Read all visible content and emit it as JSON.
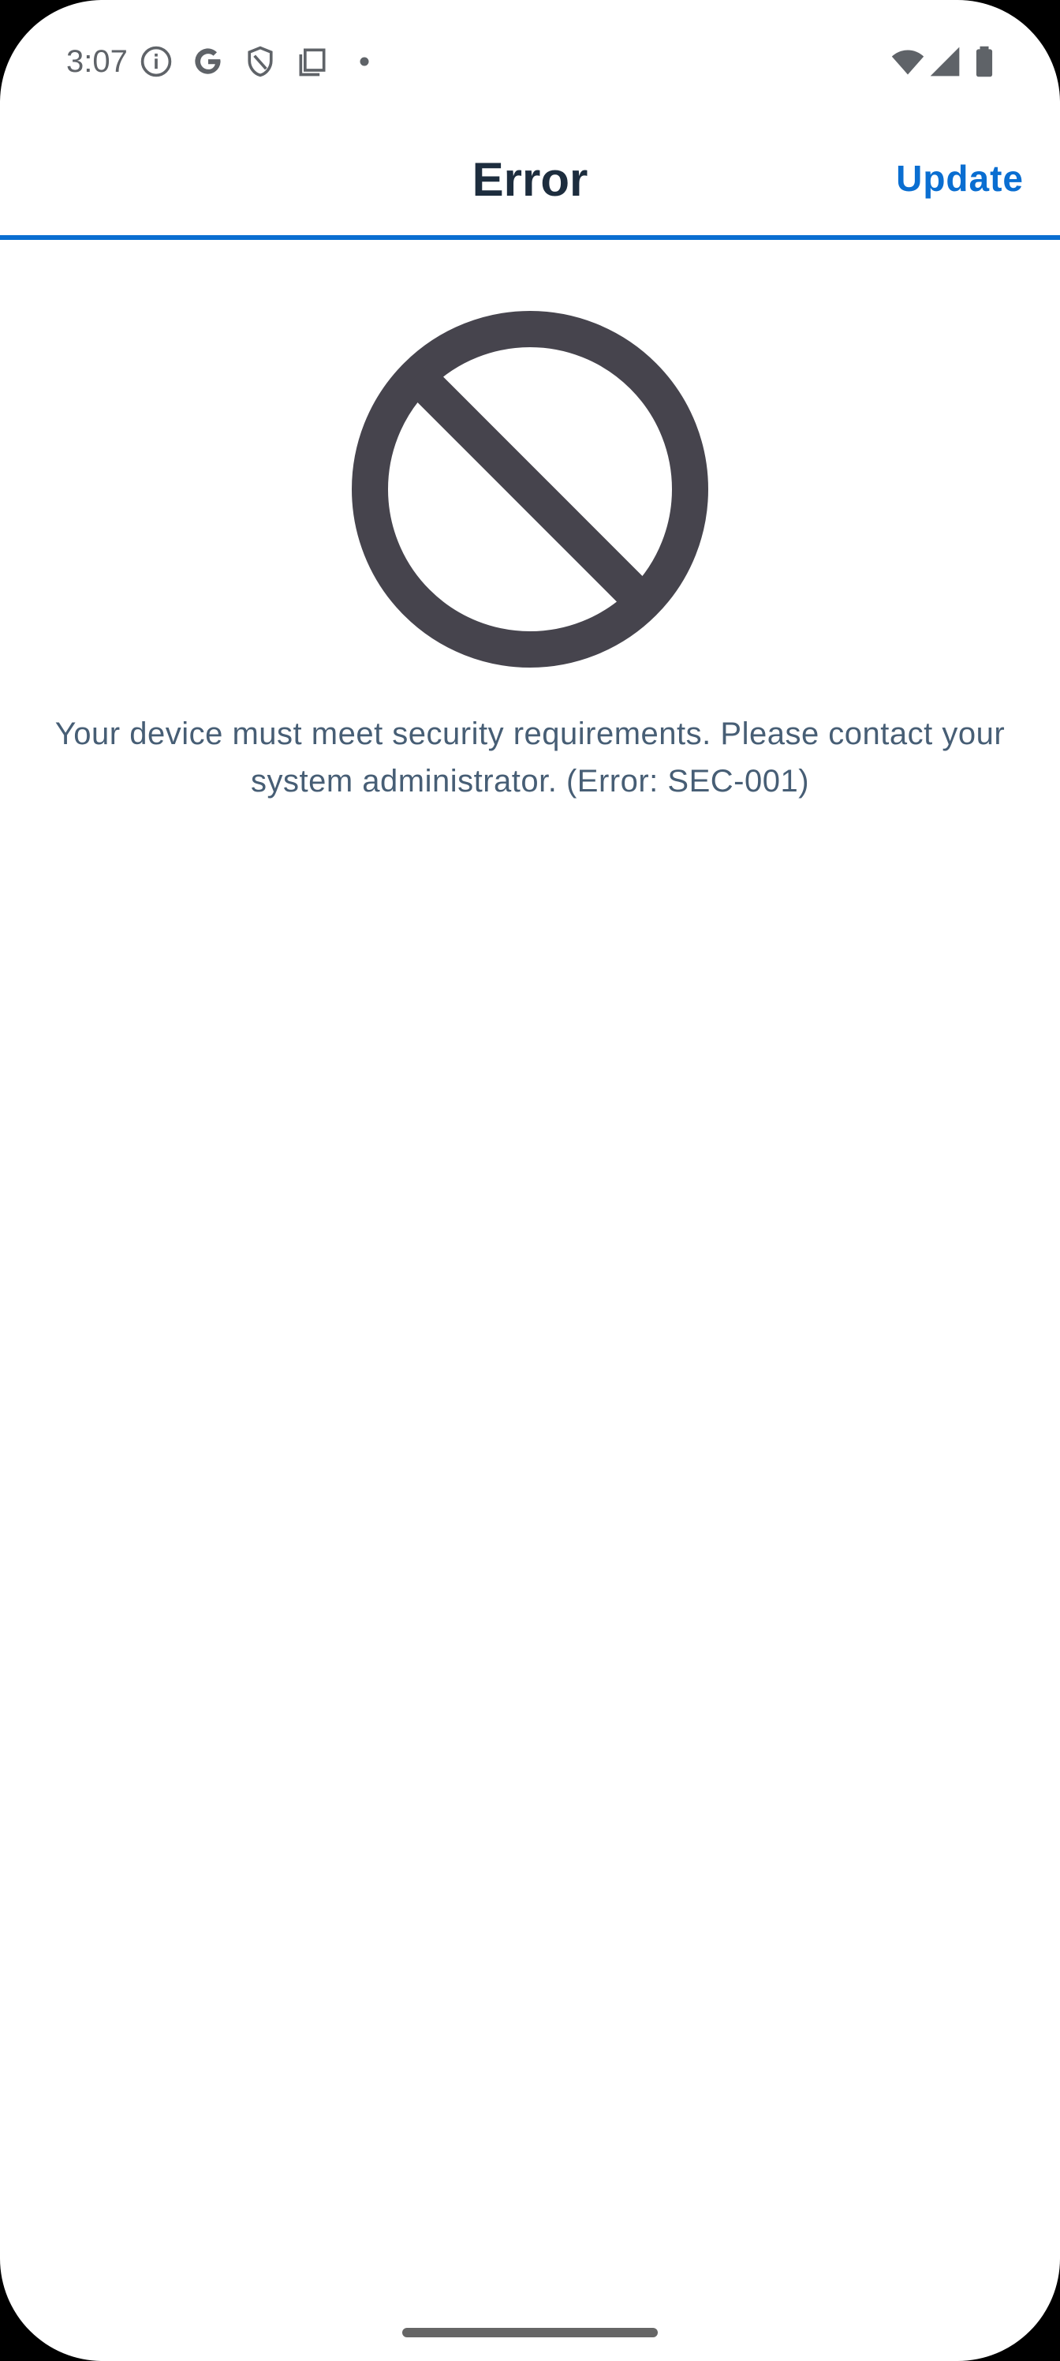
{
  "status_bar": {
    "time": "3:07",
    "left_icons": [
      "info-icon",
      "google-icon",
      "shield-icon",
      "copy-icon",
      "dot-icon"
    ],
    "right_icons": [
      "wifi-icon",
      "signal-icon",
      "battery-icon"
    ]
  },
  "app_bar": {
    "title": "Error",
    "action_label": "Update"
  },
  "content": {
    "icon": "prohibited-icon",
    "message": "Your device must meet security requirements. Please contact your system administrator. (Error: SEC-001)"
  },
  "colors": {
    "accent": "#0a6ed1",
    "title": "#1d2d3e",
    "message": "#475e75",
    "icon": "#46444d",
    "status": "#5f6368"
  }
}
